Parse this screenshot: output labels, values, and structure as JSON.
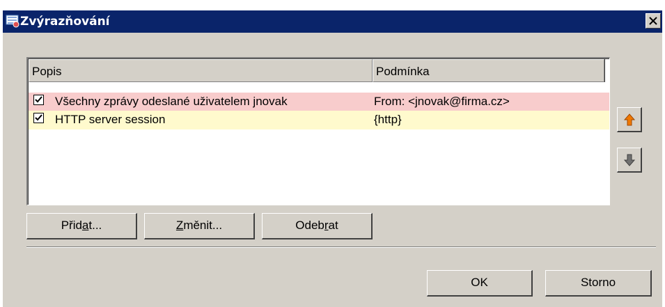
{
  "window": {
    "title": "Zvýrazňování",
    "title_icon": "highlighting-app-icon",
    "close_icon": "close-icon"
  },
  "table": {
    "columns": [
      "Popis",
      "Podmínka"
    ],
    "rows": [
      {
        "checked": true,
        "popis": "Všechny zprávy odeslané uživatelem jnovak",
        "podminka": "From: <jnovak@firma.cz>",
        "color": "#f8cccc"
      },
      {
        "checked": true,
        "popis": "HTTP server session",
        "podminka": "{http}",
        "color": "#fffacd"
      }
    ]
  },
  "side_buttons": {
    "up_icon": "arrow-up-icon",
    "down_icon": "arrow-down-icon",
    "up_color": "#f07800",
    "down_color": "#707070"
  },
  "buttons": {
    "add": {
      "pre": "Přid",
      "ul": "a",
      "post": "t..."
    },
    "edit": {
      "pre": "",
      "ul": "Z",
      "post": "měnit..."
    },
    "remove": {
      "pre": "Odeb",
      "ul": "r",
      "post": "at"
    },
    "ok": "OK",
    "cancel": "Storno"
  },
  "colors": {
    "titlebar": "#0a246a",
    "dialog_bg": "#d4d0c8"
  }
}
